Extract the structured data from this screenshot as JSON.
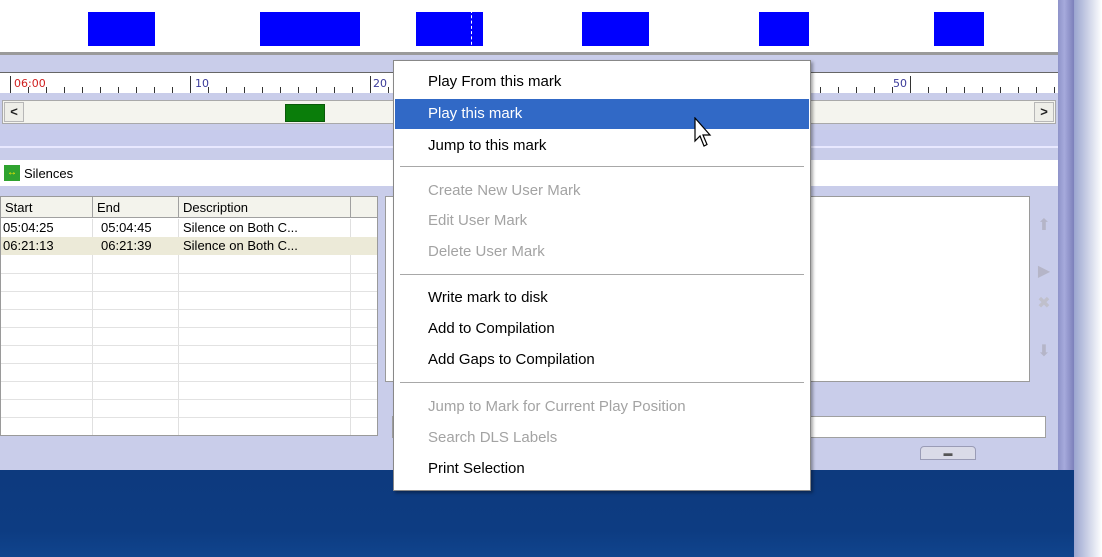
{
  "ruler": {
    "labels": [
      "06:00",
      "10",
      "20",
      "50"
    ]
  },
  "scrollbar": {
    "left_arrow": "<",
    "right_arrow": ">"
  },
  "silences": {
    "title": "Silences",
    "columns": [
      "Start",
      "End",
      "Description"
    ],
    "rows": [
      {
        "start": "05:04:25",
        "end": "05:04:45",
        "description": "Silence on Both C..."
      },
      {
        "start": "06:21:13",
        "end": "06:21:39",
        "description": "Silence on Both C..."
      }
    ]
  },
  "context_menu": {
    "items": [
      {
        "label": "Play From this mark",
        "enabled": true
      },
      {
        "label": "Play this mark",
        "enabled": true,
        "highlighted": true
      },
      {
        "label": "Jump to this mark",
        "enabled": true
      },
      {
        "label": "Create New User Mark",
        "enabled": false
      },
      {
        "label": "Edit User Mark",
        "enabled": false
      },
      {
        "label": "Delete User Mark",
        "enabled": false
      },
      {
        "label": "Write mark to disk",
        "enabled": true
      },
      {
        "label": "Add to Compilation",
        "enabled": true
      },
      {
        "label": "Add Gaps to Compilation",
        "enabled": true
      },
      {
        "label": "Jump to Mark for Current Play Position",
        "enabled": false
      },
      {
        "label": "Search DLS Labels",
        "enabled": false
      },
      {
        "label": "Print Selection",
        "enabled": true
      }
    ]
  },
  "colors": {
    "mark_block": "#0000ff",
    "scroll_thumb": "#0a7d0a",
    "menu_highlight": "#3169c6",
    "footer": "#0d3a7e"
  }
}
